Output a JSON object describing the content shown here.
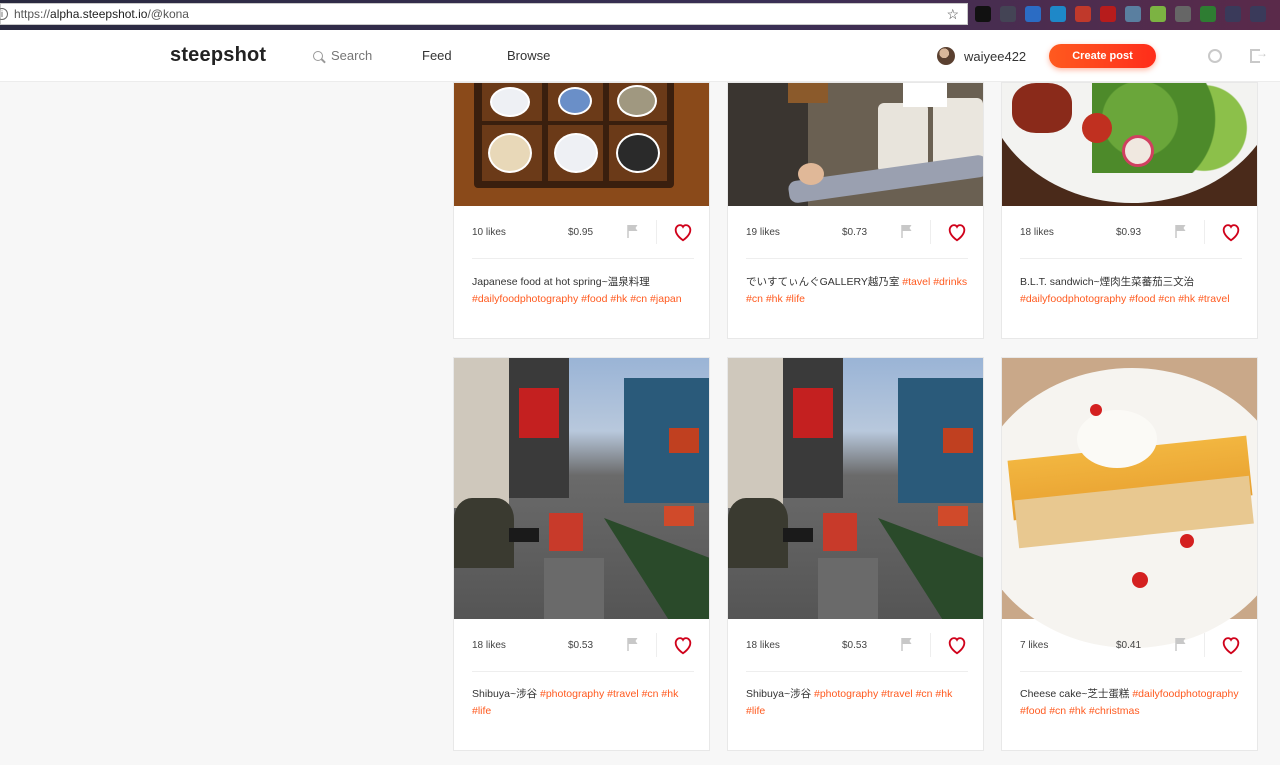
{
  "browser": {
    "url_scheme": "https://",
    "url_host": "alpha.steepshot.io",
    "url_path": "/@kona"
  },
  "header": {
    "logo": "steepshot",
    "search_placeholder": "Search",
    "nav": [
      "Feed",
      "Browse"
    ],
    "username": "waiyee422",
    "create_label": "Create post"
  },
  "colors": {
    "accent": "#ff5a1f",
    "heart": "#d0021b",
    "flag": "#c8c8c8"
  },
  "cards": [
    {
      "likes": "10 likes",
      "price": "$0.95",
      "title": "Japanese food at hot spring~温泉料理",
      "tags": "#dailyfoodphotography #food #hk #cn #japan"
    },
    {
      "likes": "19 likes",
      "price": "$0.73",
      "title": "でいすてぃんぐGALLERY越乃室",
      "tags": "#tavel #drinks #cn #hk #life"
    },
    {
      "likes": "18 likes",
      "price": "$0.93",
      "title": "B.L.T. sandwich~煙肉生菜蕃茄三文治",
      "tags": "#dailyfoodphotography #food #cn #hk #travel"
    },
    {
      "likes": "18 likes",
      "price": "$0.53",
      "title": "Shibuya~涉谷",
      "tags": "#photography #travel #cn #hk #life"
    },
    {
      "likes": "18 likes",
      "price": "$0.53",
      "title": "Shibuya~涉谷",
      "tags": "#photography #travel #cn #hk #life"
    },
    {
      "likes": "7 likes",
      "price": "$0.41",
      "title": "Cheese cake~芝士蛋糕",
      "tags": "#dailyfoodphotography #food #cn #hk #christmas"
    }
  ]
}
